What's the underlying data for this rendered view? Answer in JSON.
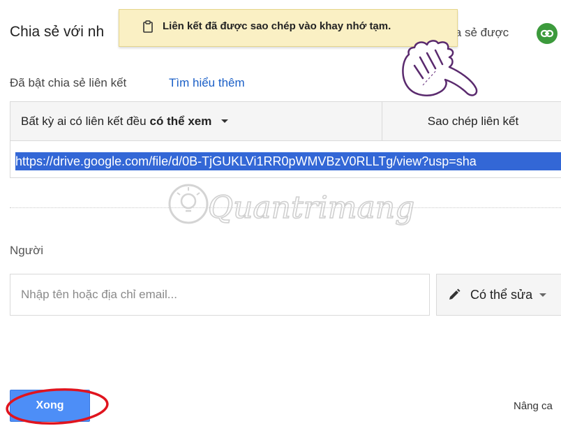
{
  "header": {
    "title": "Chia sẻ với nh",
    "title_right": "ia sẻ được"
  },
  "toast": {
    "message": "Liên kết đã được sao chép vào khay nhớ tạm."
  },
  "link_sharing": {
    "enabled_text": "Đã bật chia sẻ liên kết",
    "learn_more": "Tìm hiểu thêm",
    "permission_prefix": "Bất kỳ ai có liên kết đều",
    "permission_bold": "có thể xem",
    "copy_link_label": "Sao chép liên kết",
    "url": "https://drive.google.com/file/d/0B-TjGUKLVi1RR0pWMVBzV0RLLTg/view?usp=sha"
  },
  "watermark": "Quantrimang",
  "people": {
    "label": "Người",
    "placeholder": "Nhập tên hoặc địa chỉ email...",
    "permission_label": "Có thể sửa"
  },
  "footer": {
    "done_label": "Xong",
    "advanced_label": "Nâng ca"
  },
  "colors": {
    "accent": "#4d8ef7",
    "link": "#1a5fc7",
    "selection": "#3367d6",
    "toast_bg": "#faf0c4",
    "badge_green": "#3c9a3c",
    "highlight_ring": "#e0141e"
  },
  "icons": {
    "toast": "clipboard-icon",
    "badge": "link-icon",
    "permission": "pencil-icon",
    "caret": "caret-down-icon",
    "pointer": "pointing-hand-icon"
  }
}
